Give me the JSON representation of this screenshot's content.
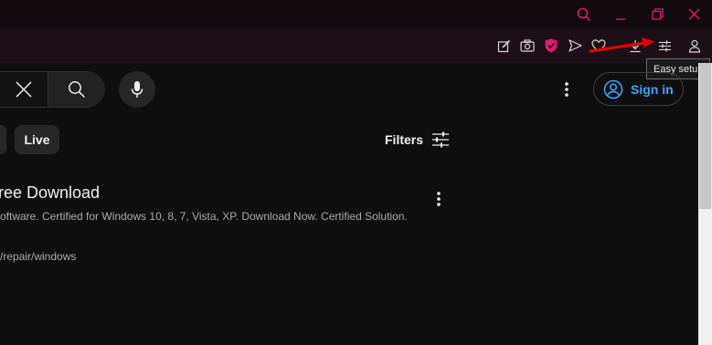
{
  "window": {
    "controls": [
      "search-icon",
      "minimize-icon",
      "restore-icon",
      "close-icon"
    ]
  },
  "browser_toolbar": {
    "icons": [
      "edit-icon",
      "camera-icon",
      "shield-icon",
      "send-icon",
      "heart-icon",
      "download-icon",
      "easy-setup-icon",
      "profile-icon"
    ],
    "tooltip": "Easy setup"
  },
  "header": {
    "signin_label": "Sign in"
  },
  "chips": {
    "live": "Live"
  },
  "filters": {
    "label": "Filters"
  },
  "result": {
    "title": "ree Download",
    "description": "oftware. Certified for Windows 10, 8, 7, Vista, XP. Download Now. Certified Solution.",
    "url": "/repair/windows"
  },
  "colors": {
    "accent_pink": "#e01a6e",
    "link_blue": "#3ea6ff",
    "annotation_red": "#e00000"
  }
}
